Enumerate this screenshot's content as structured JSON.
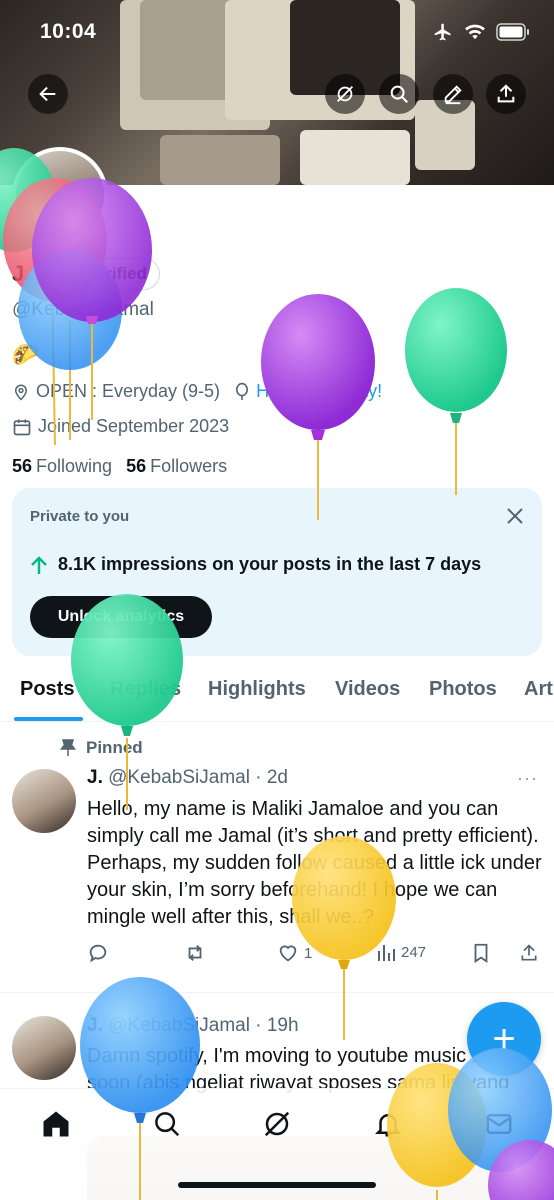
{
  "status": {
    "time": "10:04"
  },
  "header": {
    "back_icon": "arrow-left-icon",
    "actions": [
      "grok-icon",
      "search-icon",
      "edit-icon",
      "share-icon"
    ]
  },
  "profile": {
    "name": "J.",
    "verified_label": "Get verified",
    "handle": "@KebabSiJamal",
    "bio_emoji": "🌮",
    "location": "OPEN : Everyday (9-5)",
    "birthday": "Happy birthday!",
    "joined": "Joined September 2023",
    "following_count": "56",
    "following_label": "Following",
    "followers_count": "56",
    "followers_label": "Followers"
  },
  "analytics": {
    "private_label": "Private to you",
    "impressions_text": "8.1K impressions on your posts in the last 7 days",
    "unlock_label": "Unlock analytics"
  },
  "tabs": [
    "Posts",
    "Replies",
    "Highlights",
    "Videos",
    "Photos",
    "Art"
  ],
  "posts": [
    {
      "pinned_label": "Pinned",
      "name": "J.",
      "handle": "@KebabSiJamal",
      "time": "· 2d",
      "text": "Hello, my name is Maliki Jamaloe and you can simply call me Jamal (it’s short and pretty efficient). Perhaps, my sudden follow caused a little ick under your skin, I’m sorry beforehand! I hope we can mingle well after this, shall we..?",
      "likes": "1",
      "views": "247"
    },
    {
      "name": "J.",
      "handle": "@KebabSiJamal",
      "time": "· 19h",
      "text": "Damn spotify, I'm moving to youtube music real soon (abis ngeliat riwayat sposes sama lis yang pernah kita usahakan jadinya gini"
    }
  ],
  "fab": {
    "label": "+"
  },
  "colors": {
    "accent": "#1d9bf0",
    "text": "#0f1419",
    "muted": "#536471"
  }
}
